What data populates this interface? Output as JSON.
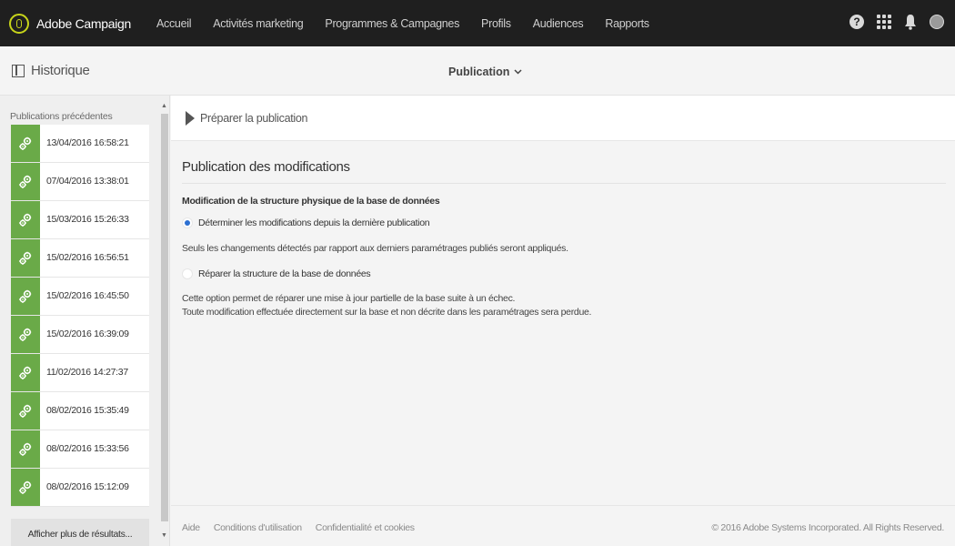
{
  "topbar": {
    "brand": "Adobe Campaign",
    "nav": [
      "Accueil",
      "Activités marketing",
      "Programmes & Campagnes",
      "Profils",
      "Audiences",
      "Rapports"
    ],
    "icons": [
      "help-icon",
      "apps-icon",
      "bell-icon",
      "avatar"
    ],
    "help_glyph": "?"
  },
  "header": {
    "title": "Historique",
    "dropdown": "Publication"
  },
  "sidebar": {
    "label": "Publications précédentes",
    "items": [
      {
        "date": "13/04/2016 16:58:21"
      },
      {
        "date": "07/04/2016 13:38:01"
      },
      {
        "date": "15/03/2016 15:26:33"
      },
      {
        "date": "15/02/2016 16:56:51"
      },
      {
        "date": "15/02/2016 16:45:50"
      },
      {
        "date": "15/02/2016 16:39:09"
      },
      {
        "date": "11/02/2016 14:27:37"
      },
      {
        "date": "08/02/2016 15:35:49"
      },
      {
        "date": "08/02/2016 15:33:56"
      },
      {
        "date": "08/02/2016 15:12:09"
      }
    ],
    "more_button": "Afficher plus de résultats..."
  },
  "main": {
    "prepare_label": "Préparer la publication",
    "section_title": "Publication des modifications",
    "subsection_title": "Modification de la structure physique de la base de données",
    "option1": {
      "label": "Déterminer les modifications depuis la dernière publication",
      "selected": true
    },
    "option1_desc": "Seuls les changements détectés par rapport aux derniers paramétrages publiés seront appliqués.",
    "option2": {
      "label": "Réparer la structure de la base de données",
      "selected": false
    },
    "option2_desc_line1": "Cette option permet de réparer une mise à jour partielle de la base suite à un échec.",
    "option2_desc_line2": "Toute modification effectuée directement sur la base et non décrite dans les paramétrages sera perdue."
  },
  "footer": {
    "links": [
      "Aide",
      "Conditions d'utilisation",
      "Confidentialité et cookies"
    ],
    "copyright": "© 2016 Adobe Systems Incorporated. All Rights Reserved."
  },
  "colors": {
    "topbar": "#1f1f1f",
    "brand_accent": "#c7d41a",
    "publication_green": "#6aaa48",
    "radio_selected": "#2c6fd1"
  }
}
